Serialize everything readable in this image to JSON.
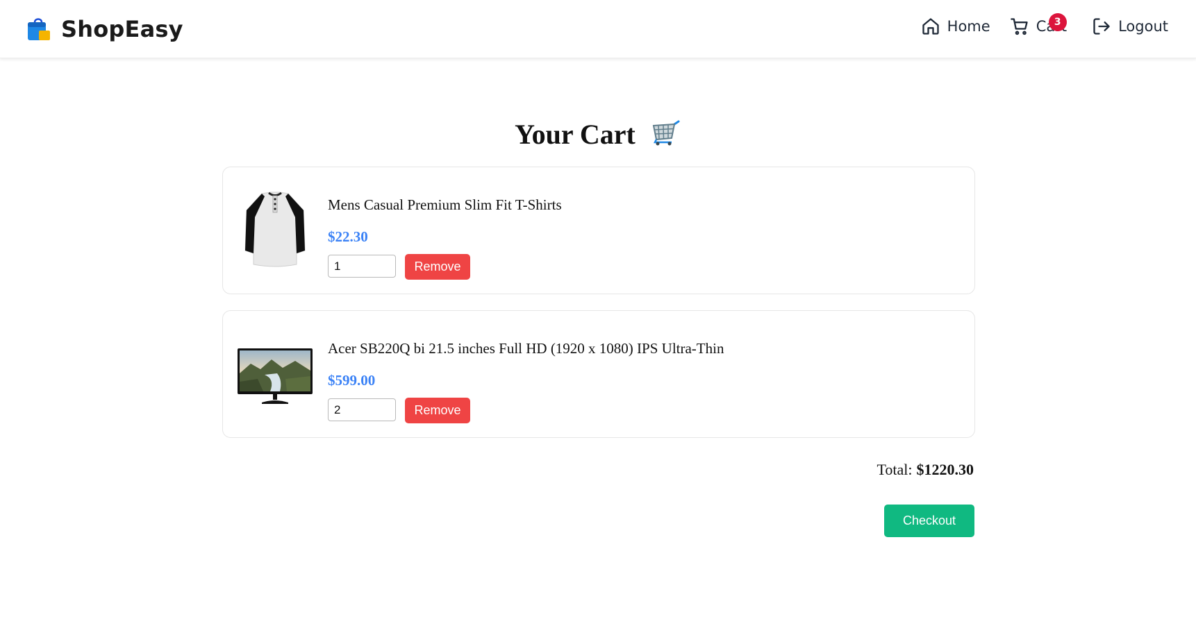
{
  "header": {
    "brand": "ShopEasy",
    "brand_icon": "shopping-bag-icon",
    "nav": {
      "home_label": "Home",
      "cart_label": "Cart",
      "cart_count": "3",
      "logout_label": "Logout"
    }
  },
  "main": {
    "title": "Your Cart",
    "title_icon": "shopping-cart-emoji-icon",
    "items": [
      {
        "title": "Mens Casual Premium Slim Fit T-Shirts",
        "price": "$22.30",
        "quantity": "1",
        "remove_label": "Remove",
        "image": "raglan-tshirt-image"
      },
      {
        "title": "Acer SB220Q bi 21.5 inches Full HD (1920 x 1080) IPS Ultra-Thin",
        "price": "$599.00",
        "quantity": "2",
        "remove_label": "Remove",
        "image": "monitor-image"
      }
    ],
    "total_label": "Total:",
    "total_value": "$1220.30",
    "checkout_label": "Checkout"
  },
  "colors": {
    "price": "#3b82f6",
    "remove": "#ef4444",
    "checkout": "#10b981",
    "badge": "#dc143c"
  }
}
